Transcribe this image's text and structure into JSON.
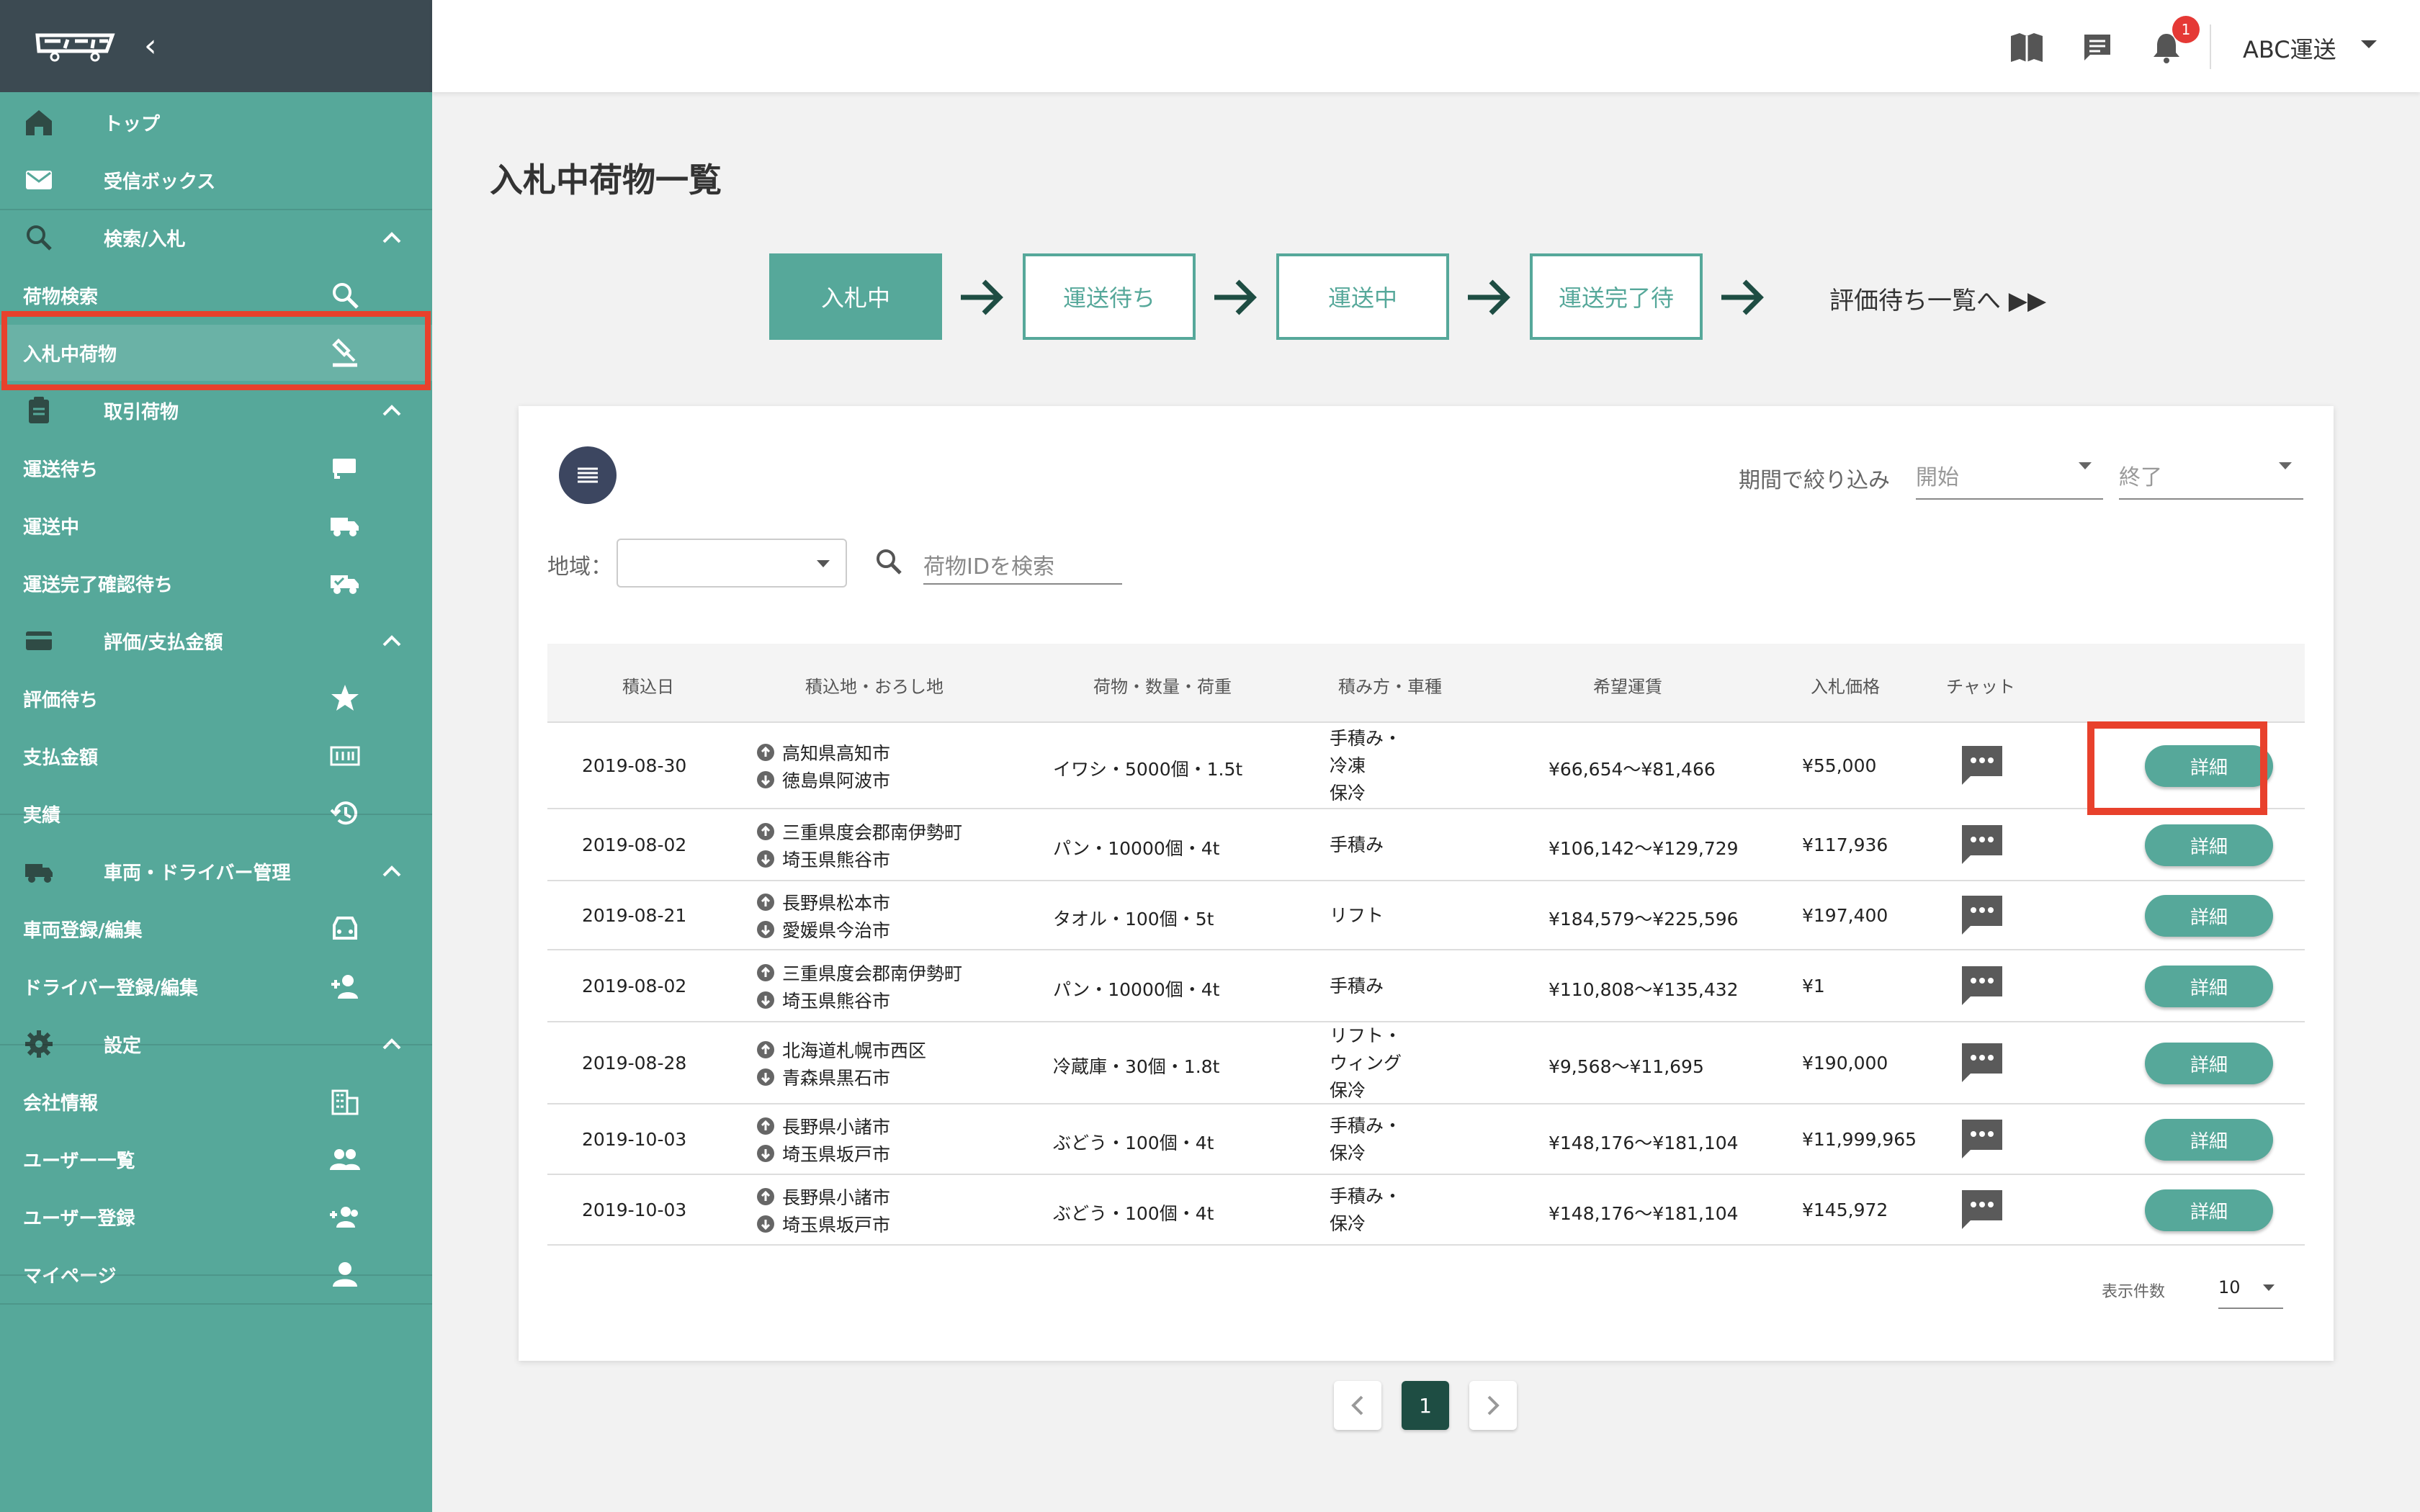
{
  "app": {
    "name": "ABC運送"
  },
  "header": {
    "notifications_count": "1",
    "company": "ABC運送"
  },
  "sidebar": {
    "items": [
      {
        "label": "トップ",
        "icon": "home-icon"
      },
      {
        "label": "受信ボックス",
        "icon": "mail-icon"
      },
      {
        "label": "検索/入札",
        "icon": "search-icon",
        "group": true
      },
      {
        "label": "荷物検索",
        "icon": "search-icon"
      },
      {
        "label": "入札中荷物",
        "icon": "gavel-icon",
        "active": true
      },
      {
        "label": "取引荷物",
        "icon": "clipboard-icon",
        "group": true
      },
      {
        "label": "運送待ち",
        "icon": "truck-wait-icon"
      },
      {
        "label": "運送中",
        "icon": "truck-icon"
      },
      {
        "label": "運送完了確認待ち",
        "icon": "truck-check-icon"
      },
      {
        "label": "評価/支払金額",
        "icon": "credit-card-icon",
        "group": true
      },
      {
        "label": "評価待ち",
        "icon": "star-icon"
      },
      {
        "label": "支払金額",
        "icon": "money-icon"
      },
      {
        "label": "実績",
        "icon": "history-icon"
      },
      {
        "label": "車両・ドライバー管理",
        "icon": "truck-icon",
        "group": true
      },
      {
        "label": "車両登録/編集",
        "icon": "car-icon"
      },
      {
        "label": "ドライバー登録/編集",
        "icon": "person-add-icon"
      },
      {
        "label": "設定",
        "icon": "gear-icon",
        "group": true
      },
      {
        "label": "会社情報",
        "icon": "building-icon"
      },
      {
        "label": "ユーザー一覧",
        "icon": "people-icon"
      },
      {
        "label": "ユーザー登録",
        "icon": "group-add-icon"
      },
      {
        "label": "マイページ",
        "icon": "person-icon"
      }
    ]
  },
  "page": {
    "title": "入札中荷物一覧"
  },
  "steps": {
    "s1": "入札中",
    "s2": "運送待ち",
    "s3": "運送中",
    "s4": "運送完了待",
    "link": "評価待ち一覧へ ▶▶"
  },
  "filters": {
    "period_label": "期間で絞り込み",
    "start_placeholder": "開始",
    "end_placeholder": "終了",
    "region_label": "地域：",
    "region_value": "",
    "search_placeholder": "荷物IDを検索"
  },
  "table": {
    "headers": {
      "date": "積込日",
      "location": "積込地・おろし地",
      "cargo": "荷物・数量・荷重",
      "method": "積み方・車種",
      "fare": "希望運賃",
      "bid": "入札価格",
      "chat": "チャット"
    },
    "detail_label": "詳細",
    "rows": [
      {
        "date": "2019-08-30",
        "from": "高知県高知市",
        "to": "徳島県阿波市",
        "cargo": "イワシ・5000個・1.5t",
        "method": [
          "手積み・",
          "冷凍",
          "保冷"
        ],
        "fare": "¥66,654〜¥81,466",
        "bid": "¥55,000"
      },
      {
        "date": "2019-08-02",
        "from": "三重県度会郡南伊勢町",
        "to": "埼玉県熊谷市",
        "cargo": "パン・10000個・4t",
        "method": [
          "手積み"
        ],
        "fare": "¥106,142〜¥129,729",
        "bid": "¥117,936"
      },
      {
        "date": "2019-08-21",
        "from": "長野県松本市",
        "to": "愛媛県今治市",
        "cargo": "タオル・100個・5t",
        "method": [
          "リフト"
        ],
        "fare": "¥184,579〜¥225,596",
        "bid": "¥197,400"
      },
      {
        "date": "2019-08-02",
        "from": "三重県度会郡南伊勢町",
        "to": "埼玉県熊谷市",
        "cargo": "パン・10000個・4t",
        "method": [
          "手積み"
        ],
        "fare": "¥110,808〜¥135,432",
        "bid": "¥1"
      },
      {
        "date": "2019-08-28",
        "from": "北海道札幌市西区",
        "to": "青森県黒石市",
        "cargo": "冷蔵庫・30個・1.8t",
        "method": [
          "リフト・",
          "ウィング",
          "保冷"
        ],
        "fare": "¥9,568〜¥11,695",
        "bid": "¥190,000"
      },
      {
        "date": "2019-10-03",
        "from": "長野県小諸市",
        "to": "埼玉県坂戸市",
        "cargo": "ぶどう・100個・4t",
        "method": [
          "手積み・",
          "保冷"
        ],
        "fare": "¥148,176〜¥181,104",
        "bid": "¥11,999,965"
      },
      {
        "date": "2019-10-03",
        "from": "長野県小諸市",
        "to": "埼玉県坂戸市",
        "cargo": "ぶどう・100個・4t",
        "method": [
          "手積み・",
          "保冷"
        ],
        "fare": "¥148,176〜¥181,104",
        "bid": "¥145,972"
      }
    ]
  },
  "pagination": {
    "per_page_label": "表示件数",
    "per_page": "10",
    "current": "1"
  },
  "colors": {
    "accent": "#56a89a",
    "sidebar_dark": "#3c4a52",
    "highlight": "#e8412c",
    "page_current": "#1e4d43"
  }
}
